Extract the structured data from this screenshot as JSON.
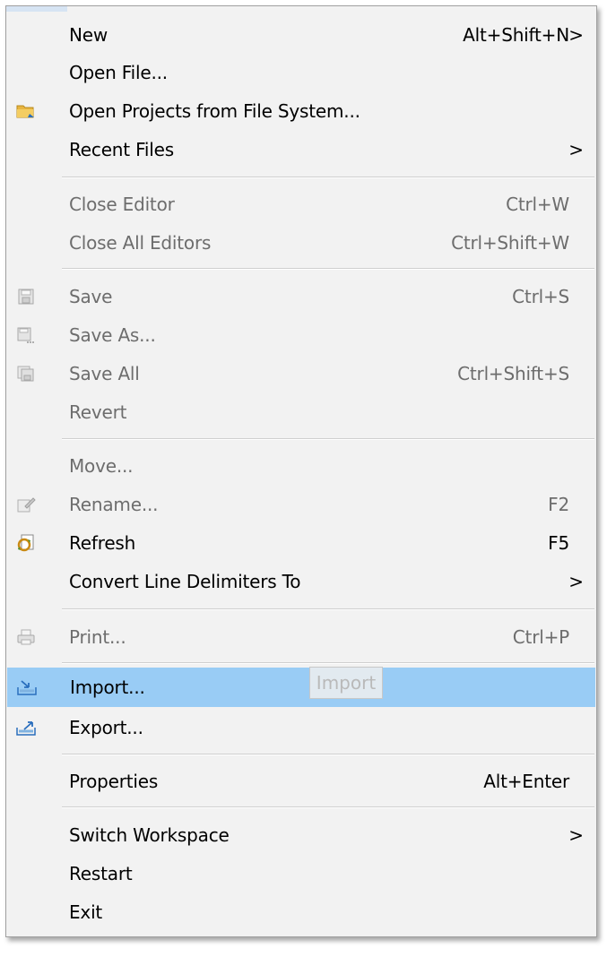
{
  "menu": {
    "items": [
      {
        "key": "new",
        "label": "New",
        "shortcut": "Alt+Shift+N",
        "submenu": true,
        "enabled": true
      },
      {
        "key": "open_file",
        "label": "Open File...",
        "shortcut": "",
        "enabled": true
      },
      {
        "key": "open_projects",
        "label": "Open Projects from File System...",
        "shortcut": "",
        "icon": "folder-icon",
        "enabled": true
      },
      {
        "key": "recent_files",
        "label": "Recent Files",
        "shortcut": "",
        "submenu": true,
        "enabled": true
      },
      {
        "key": "close_editor",
        "label": "Close Editor",
        "shortcut": "Ctrl+W",
        "enabled": false
      },
      {
        "key": "close_all_editors",
        "label": "Close All Editors",
        "shortcut": "Ctrl+Shift+W",
        "enabled": false
      },
      {
        "key": "save",
        "label": "Save",
        "shortcut": "Ctrl+S",
        "icon": "save-icon",
        "enabled": false
      },
      {
        "key": "save_as",
        "label": "Save As...",
        "shortcut": "",
        "icon": "save-as-icon",
        "enabled": false
      },
      {
        "key": "save_all",
        "label": "Save All",
        "shortcut": "Ctrl+Shift+S",
        "icon": "save-all-icon",
        "enabled": false
      },
      {
        "key": "revert",
        "label": "Revert",
        "shortcut": "",
        "enabled": false
      },
      {
        "key": "move",
        "label": "Move...",
        "shortcut": "",
        "enabled": false
      },
      {
        "key": "rename",
        "label": "Rename...",
        "shortcut": "F2",
        "icon": "rename-icon",
        "enabled": false
      },
      {
        "key": "refresh",
        "label": "Refresh",
        "shortcut": "F5",
        "icon": "refresh-icon",
        "enabled": true
      },
      {
        "key": "convert_line_delimiters",
        "label": "Convert Line Delimiters To",
        "shortcut": "",
        "submenu": true,
        "enabled": true
      },
      {
        "key": "print",
        "label": "Print...",
        "shortcut": "Ctrl+P",
        "icon": "print-icon",
        "enabled": false
      },
      {
        "key": "import",
        "label": "Import...",
        "shortcut": "",
        "icon": "import-icon",
        "enabled": true,
        "highlighted": true
      },
      {
        "key": "export",
        "label": "Export...",
        "shortcut": "",
        "icon": "export-icon",
        "enabled": true
      },
      {
        "key": "properties",
        "label": "Properties",
        "shortcut": "Alt+Enter",
        "enabled": true
      },
      {
        "key": "switch_workspace",
        "label": "Switch Workspace",
        "shortcut": "",
        "submenu": true,
        "enabled": true
      },
      {
        "key": "restart",
        "label": "Restart",
        "shortcut": "",
        "enabled": true
      },
      {
        "key": "exit",
        "label": "Exit",
        "shortcut": "",
        "enabled": true
      }
    ],
    "submenu_arrow": ">",
    "tooltip": "Import",
    "highlight_color": "#99ccf5",
    "disabled_text_color": "#6d6d6d"
  }
}
